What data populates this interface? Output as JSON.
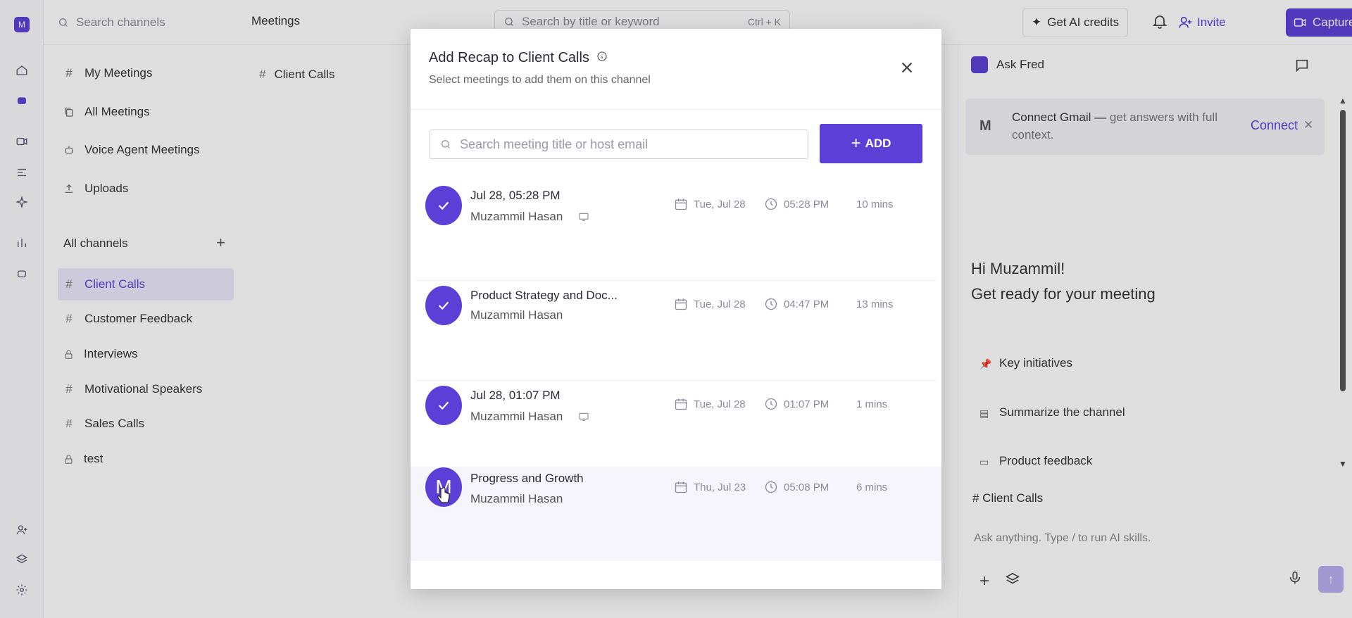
{
  "app": {
    "logo_letter": "M",
    "channel_search_placeholder": "Search channels",
    "breadcrumb": "Meetings",
    "global_search_placeholder": "Search by title or keyword",
    "global_search_shortcut": "Ctrl + K",
    "ai_credits_label": "Get AI credits",
    "invite_label": "Invite",
    "capture_label": "Capture"
  },
  "sidebar": {
    "items": [
      {
        "label": "My Meetings",
        "icon": "hash-icon"
      },
      {
        "label": "All Meetings",
        "icon": "copy-icon"
      },
      {
        "label": "Voice Agent Meetings",
        "icon": "bot-icon"
      },
      {
        "label": "Uploads",
        "icon": "upload-icon"
      }
    ],
    "all_channels_label": "All channels",
    "channels": [
      {
        "label": "Client Calls",
        "icon": "hash-icon",
        "active": true
      },
      {
        "label": "Customer Feedback",
        "icon": "hash-icon"
      },
      {
        "label": "Interviews",
        "icon": "lock-icon"
      },
      {
        "label": "Motivational Speakers",
        "icon": "hash-icon"
      },
      {
        "label": "Sales Calls",
        "icon": "hash-icon"
      },
      {
        "label": "test",
        "icon": "lock-icon"
      }
    ]
  },
  "center": {
    "channel_title": "Client Calls"
  },
  "right_panel": {
    "ask_label": "Ask Fred",
    "gmail_title": "Connect Gmail —",
    "gmail_text": "get answers with full context.",
    "gmail_connect": "Connect",
    "greeting_line1": "Hi Muzammil!",
    "greeting_line2": "Get ready for your meeting",
    "suggestions": [
      "Key initiatives",
      "Summarize the channel",
      "Product feedback"
    ],
    "context_channel": "# Client Calls",
    "ask_placeholder": "Ask anything. Type / to run AI skills."
  },
  "modal": {
    "title": "Add Recap to Client Calls",
    "subtitle": "Select meetings to add them on this channel",
    "search_placeholder": "Search meeting title or host email",
    "add_label": "ADD",
    "meetings": [
      {
        "title": "Jul 28, 05:28 PM",
        "host": "Muzammil Hasan",
        "date": "Tue, Jul 28",
        "time": "05:28 PM",
        "duration": "10 mins",
        "selected": true,
        "screen_icon": true
      },
      {
        "title": "Product Strategy and Doc...",
        "host": "Muzammil Hasan",
        "date": "Tue, Jul 28",
        "time": "04:47 PM",
        "duration": "13 mins",
        "selected": true,
        "screen_icon": false
      },
      {
        "title": "Jul 28, 01:07 PM",
        "host": "Muzammil Hasan",
        "date": "Tue, Jul 28",
        "time": "01:07 PM",
        "duration": "1 mins",
        "selected": true,
        "screen_icon": true
      },
      {
        "title": "Progress and Growth",
        "host": "Muzammil Hasan",
        "date": "Thu, Jul 23",
        "time": "05:08 PM",
        "duration": "6 mins",
        "selected": false,
        "avatar_letter": "M",
        "screen_icon": false
      }
    ]
  },
  "colors": {
    "accent": "#5b3fd6",
    "active_bg": "#ece8fb"
  }
}
